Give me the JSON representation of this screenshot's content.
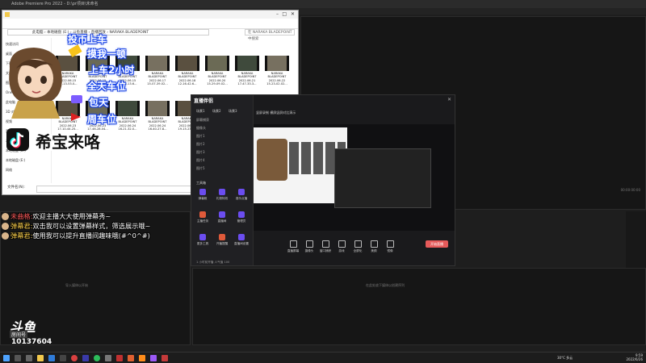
{
  "premiere": {
    "title": "Adobe Premiere Pro 2022 - D:\\pr项目\\未命名",
    "timecode_right": "00:00:00:00",
    "left_panel_hint": "导入媒体以开始",
    "right_panel_hint": "在此处放下媒体以创建序列"
  },
  "explorer": {
    "address": "此电脑 › 本地磁盘 (E:) › 斗鱼直播 › 直播回放 › NARAKA  BLADEPOINT",
    "search_placeholder": "在 NARAKA  BLADEPOINT 中搜索",
    "nav_items": [
      "快速访问",
      "桌面",
      "下载",
      "文档",
      "图片",
      "OneDrive",
      "此电脑",
      "3D 对象",
      "视频",
      "音乐",
      "本地磁盘 (C:)",
      "本地磁盘 (D:)",
      "本地磁盘 (E:)",
      "网络"
    ],
    "files": [
      "NARAKA\nBLADEPOINT\n2022.06.15\n17-13-53.0...",
      "NARAKA\nBLADEPOINT\n2022.06.15\n19-06-28.96...",
      "NARAKA\nBLADEPOINT\n2022.06.15\n19-25-13.6...",
      "NARAKA\nBLADEPOINT\n2022.06.17\n15-07-39.02...",
      "NARAKA\nBLADEPOINT\n2022.06.18\n12-16-42.6...",
      "NARAKA\nBLADEPOINT\n2022.06.20\n15-29-09.02...",
      "NARAKA\nBLADEPOINT\n2022.06.21\n17-47-33.3...",
      "NARAKA\nBLADEPOINT\n2022.06.22\n15-23-02.02...",
      "NARAKA\nBLADEPOINT\n2022.06.23\n17-10-44.25...",
      "NARAKA\nBLADEPOINT\n2022.06.23\n17-46-28.04...",
      "NARAKA\nBLADEPOINT\n2022.06.24\n16-21-32.0...",
      "NARAKA\nBLADEPOINT\n2022.06.24\n16-40-27.8...",
      "NARAKA\nBLADEPOINT\n2022.06.24\n19-15-23.6..."
    ],
    "bottom_label": "文件名(N):"
  },
  "overlay": {
    "lines": [
      "投币上车",
      "摸我一顿",
      "上车2小时",
      "全天车位",
      "包天",
      "周车位"
    ],
    "brand": "希宝来咯"
  },
  "chat": [
    {
      "name": "未曲格:",
      "text": "欢迎主播大大使用弹幕秀~"
    },
    {
      "name": "弹幕君:",
      "text": "双击我可以设置弹幕样式，筛选展示哦~"
    },
    {
      "name": "弹幕君:",
      "text": "使用我可以提升直播间趣味哦(#^0^#)"
    }
  ],
  "stream_app": {
    "logo": "直播伴侣",
    "tabs": [
      "场景1",
      "场景2",
      "场景3"
    ],
    "scenes": [
      "屏幕捕获",
      "摄像头",
      "图片1",
      "图片2",
      "图片3",
      "图片4",
      "图片5"
    ],
    "tools_title": "工具箱",
    "tools": [
      "弹幕姬",
      "礼物特效",
      "音乐点播",
      "主播任务",
      "直播间",
      "管理员",
      "更多工具",
      "开播提醒",
      "直播间设置"
    ],
    "preview_header": "竖屏录制   横屏竖屏对比演示",
    "bottom_tools": [
      "直播屏幕",
      "摄像头",
      "窗口捕获",
      "游戏",
      "全屏化",
      "美颜",
      "镜像"
    ],
    "start_button": "开始直播",
    "bottom_note": "1 小时前开播 人气值 100"
  },
  "douyu": {
    "logo": "斗鱼",
    "tag": "房间号",
    "room_id": "10137604"
  },
  "taskbar": {
    "weather": "30°C 多云",
    "time": "9:59",
    "date": "2022/6/26"
  },
  "colors": {
    "overlay_stroke": "#2255ff",
    "chat_name_1": "#ff5a5a",
    "chat_name_2": "#ffd24a",
    "accent": "#6b4df0"
  }
}
